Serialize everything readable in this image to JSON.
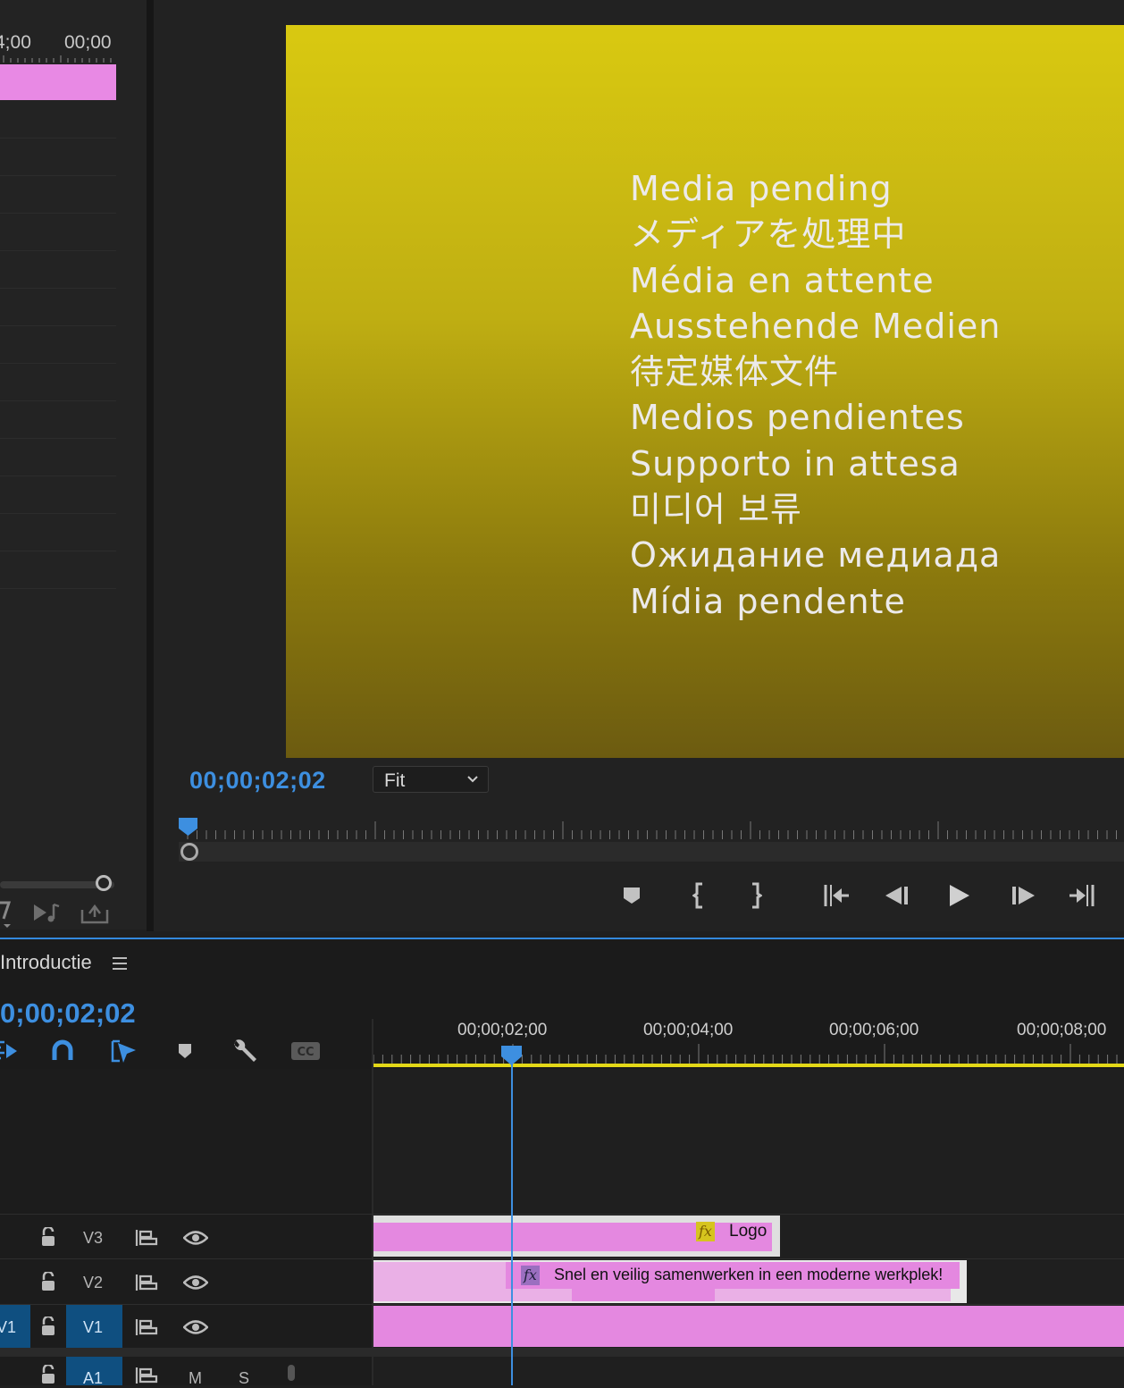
{
  "source_monitor": {
    "ruler_labels": [
      "4;00",
      "00;00"
    ],
    "bottom_icons": [
      "export-frame-icon",
      "insert-audio-icon",
      "overwrite-icon"
    ]
  },
  "program_monitor": {
    "timecode": "00;00;02;02",
    "zoom": {
      "selected": "Fit"
    },
    "media_pending_lines": [
      "Media pending",
      "メディアを処理中",
      "Média en attente",
      "Ausstehende Medien",
      "待定媒体文件",
      "Medios pendientes",
      "Supporto in attesa",
      "미디어 보류",
      "Ожидание медиада",
      "Mídia pendente"
    ],
    "frame_colors": {
      "top": "#d9c911",
      "bottom": "#6c5b10"
    },
    "transport": [
      "add-marker-icon",
      "mark-in-icon",
      "mark-out-icon",
      "go-to-in-icon",
      "step-back-icon",
      "play-icon",
      "step-forward-icon",
      "go-to-out-icon"
    ]
  },
  "timeline": {
    "sequence_name": "Introductie",
    "timecode": "0;00;02;02",
    "ruler_labels": [
      "00;00;02;00",
      "00;00;04;00",
      "00;00;06;00",
      "00;00;08;00"
    ],
    "tools": [
      "nest-icon",
      "snap-icon",
      "linked-selection-icon",
      "add-marker-icon",
      "settings-wrench-icon",
      "captions-icon"
    ],
    "tracks": [
      {
        "id": "V3",
        "patch": "",
        "clip": "Logo",
        "fx": "fx"
      },
      {
        "id": "V2",
        "patch": "",
        "clip": "Snel en veilig samenwerken in een moderne werkplek!",
        "fx": "fx"
      },
      {
        "id": "V1",
        "patch": "V1",
        "clip": "",
        "fx": ""
      },
      {
        "id": "A1",
        "patch": "",
        "clip": "",
        "fx": "",
        "mute": "M",
        "solo": "S"
      }
    ],
    "colors": {
      "accent": "#3d8fe0",
      "clip": "#e488e0",
      "work_area": "#e3d817"
    }
  }
}
